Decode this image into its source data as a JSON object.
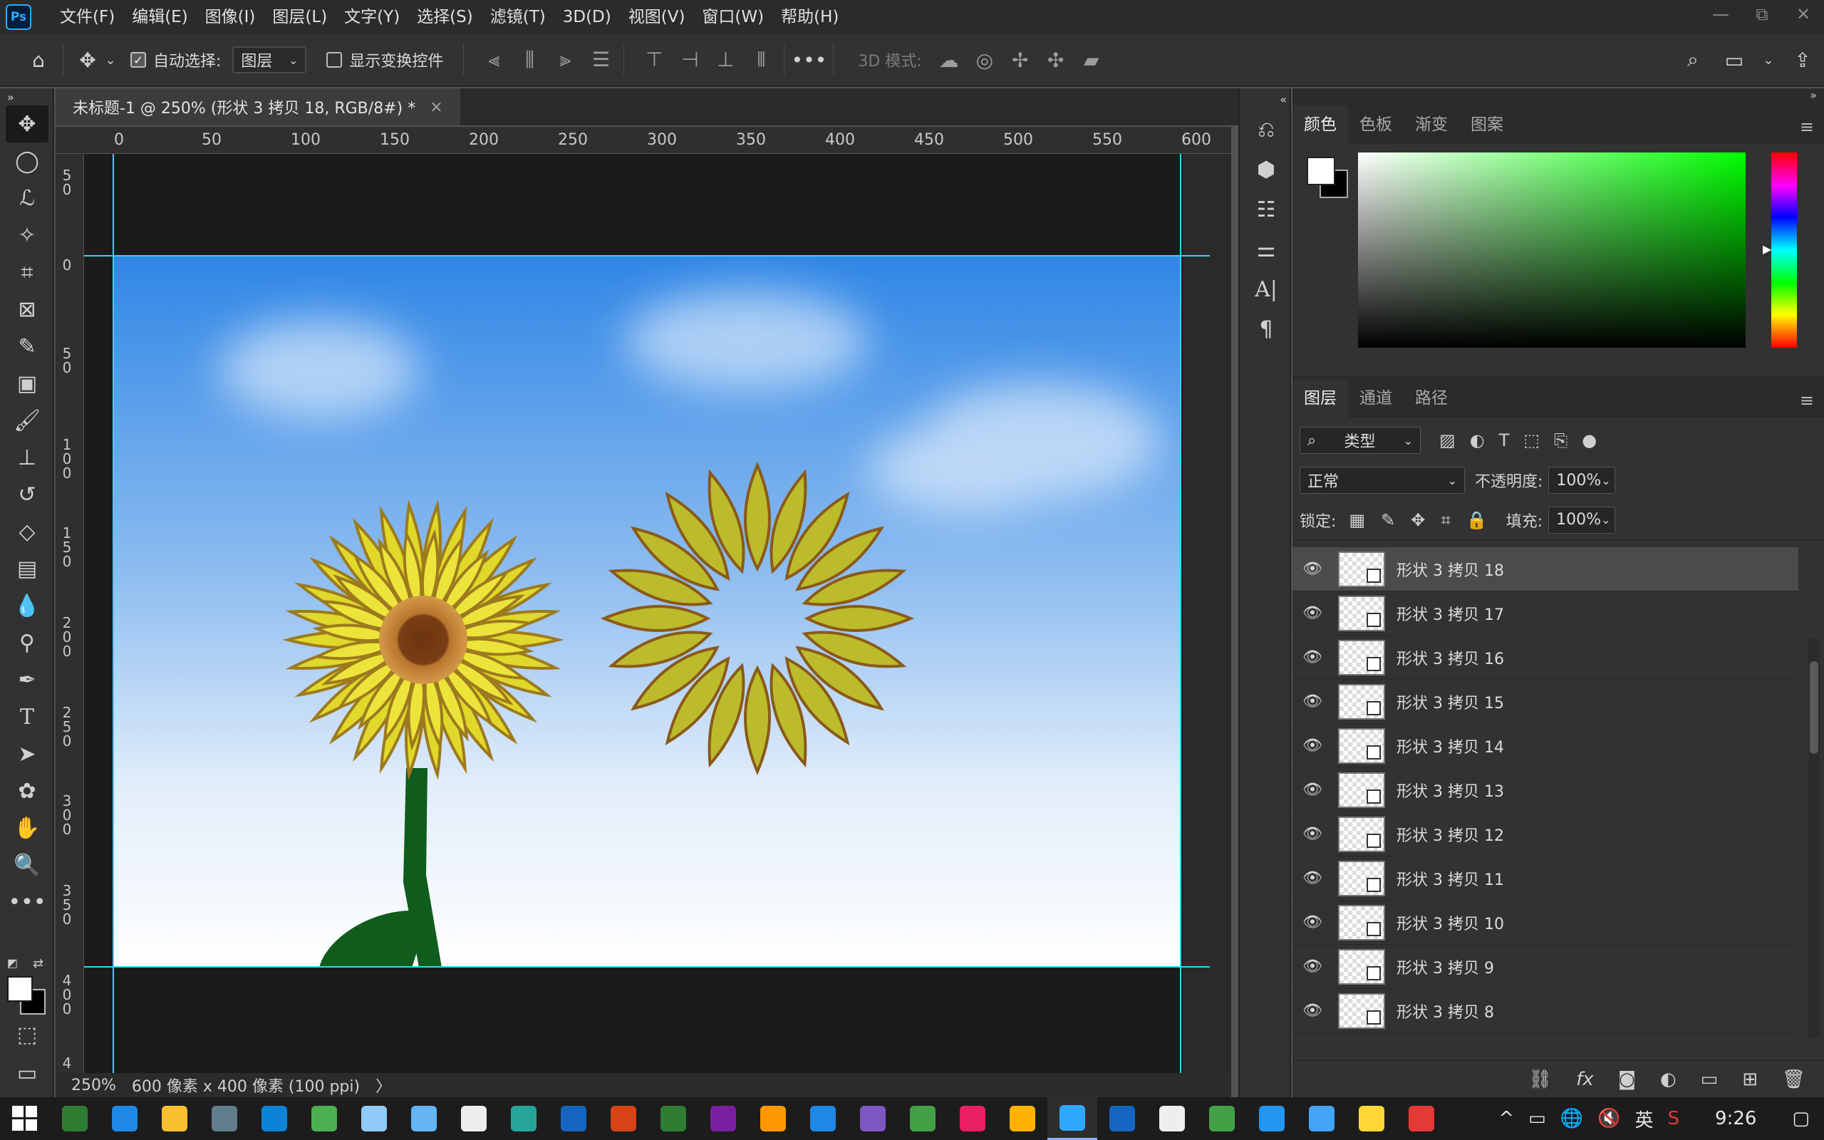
{
  "app": {
    "logo": "Ps"
  },
  "menu": [
    "文件(F)",
    "编辑(E)",
    "图像(I)",
    "图层(L)",
    "文字(Y)",
    "选择(S)",
    "滤镜(T)",
    "3D(D)",
    "视图(V)",
    "窗口(W)",
    "帮助(H)"
  ],
  "window_controls": {
    "minimize": "—",
    "restore": "⧉",
    "close": "✕"
  },
  "options": {
    "auto_select_label": "自动选择:",
    "auto_select_checked": true,
    "auto_select_target": "图层",
    "show_transform_label": "显示变换控件",
    "show_transform_checked": false,
    "more": "•••",
    "mode_3d_label": "3D 模式:"
  },
  "document": {
    "tab_title": "未标题-1 @ 250% (形状 3 拷贝 18, RGB/8#) *",
    "close": "×",
    "ruler_h": [
      "0",
      "50",
      "100",
      "150",
      "200",
      "250",
      "300",
      "350",
      "400",
      "450",
      "500",
      "550",
      "600"
    ],
    "ruler_v": [
      "5\n0",
      "0",
      "5\n0",
      "1\n0\n0",
      "1\n5\n0",
      "2\n0\n0",
      "2\n5\n0",
      "3\n0\n0",
      "3\n5\n0",
      "4\n0\n0",
      "4"
    ]
  },
  "status": {
    "zoom": "250%",
    "size": "600 像素 x 400 像素 (100 ppi)",
    "arrow": "〉"
  },
  "color_panel": {
    "tabs": [
      "颜色",
      "色板",
      "渐变",
      "图案"
    ],
    "active_tab": 0
  },
  "layers_panel": {
    "tabs": [
      "图层",
      "通道",
      "路径"
    ],
    "filter_kind": "类型",
    "blend_mode": "正常",
    "opacity_label": "不透明度:",
    "opacity": "100%",
    "lock_label": "锁定:",
    "fill_label": "填充:",
    "fill": "100%",
    "layers": [
      {
        "name": "形状 3 拷贝 18",
        "selected": true
      },
      {
        "name": "形状 3 拷贝 17",
        "selected": false
      },
      {
        "name": "形状 3 拷贝 16",
        "selected": false
      },
      {
        "name": "形状 3 拷贝 15",
        "selected": false
      },
      {
        "name": "形状 3 拷贝 14",
        "selected": false
      },
      {
        "name": "形状 3 拷贝 13",
        "selected": false
      },
      {
        "name": "形状 3 拷贝 12",
        "selected": false
      },
      {
        "name": "形状 3 拷贝 11",
        "selected": false
      },
      {
        "name": "形状 3 拷贝 10",
        "selected": false
      },
      {
        "name": "形状 3 拷贝 9",
        "selected": false
      },
      {
        "name": "形状 3 拷贝 8",
        "selected": false
      }
    ]
  },
  "taskbar": {
    "apps": [
      {
        "name": "start-icon",
        "color": "#ffffff"
      },
      {
        "name": "terminal-icon",
        "color": "#2e7d32"
      },
      {
        "name": "remote-icon",
        "color": "#1e88e5"
      },
      {
        "name": "explorer-icon",
        "color": "#fbc02d"
      },
      {
        "name": "calculator-icon",
        "color": "#607d8b"
      },
      {
        "name": "edge-icon",
        "color": "#0a84d6"
      },
      {
        "name": "chrome-icon",
        "color": "#4caf50"
      },
      {
        "name": "notepad-icon",
        "color": "#90caf9"
      },
      {
        "name": "cloud-app-icon",
        "color": "#64b5f6"
      },
      {
        "name": "typora-icon",
        "color": "#eeeeee"
      },
      {
        "name": "mindmaster-icon",
        "color": "#26a69a"
      },
      {
        "name": "word-icon",
        "color": "#1565c0"
      },
      {
        "name": "powerpoint-icon",
        "color": "#d84315"
      },
      {
        "name": "excel-icon",
        "color": "#2e7d32"
      },
      {
        "name": "onenote-icon",
        "color": "#7b1fa2"
      },
      {
        "name": "sublime-icon",
        "color": "#ff9800"
      },
      {
        "name": "vscode-icon",
        "color": "#1e88e5"
      },
      {
        "name": "visualstudio-icon",
        "color": "#7e57c2"
      },
      {
        "name": "pycharm-icon",
        "color": "#43a047"
      },
      {
        "name": "intellij-icon",
        "color": "#e91e63"
      },
      {
        "name": "notes-icon",
        "color": "#ffb300"
      },
      {
        "name": "photoshop-icon",
        "color": "#31a8ff"
      },
      {
        "name": "lightroom-icon",
        "color": "#1565c0"
      },
      {
        "name": "qq-icon",
        "color": "#eeeeee"
      },
      {
        "name": "wechat-icon",
        "color": "#43a047"
      },
      {
        "name": "feishu-icon",
        "color": "#2196f3"
      },
      {
        "name": "baidunetdisk-icon",
        "color": "#42a5f5"
      },
      {
        "name": "norton-icon",
        "color": "#fdd835"
      },
      {
        "name": "netease-music-icon",
        "color": "#e53935"
      }
    ],
    "tray": {
      "caret": "^",
      "ime": "英",
      "time": "9:26"
    }
  }
}
